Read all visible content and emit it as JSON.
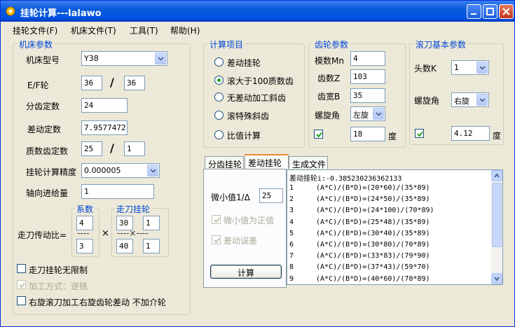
{
  "app": {
    "title": "挂轮计算---lalawo"
  },
  "menu": [
    "挂轮文件(F)",
    "机床文件(T)",
    "工具(T)",
    "帮助(H)"
  ],
  "machine": {
    "group": "机床参数",
    "model_label": "机床型号",
    "model_value": "Y38",
    "ef_label": "E/F轮",
    "ef_e": "36",
    "ef_sep": "/",
    "ef_f": "36",
    "div_label": "分齿定数",
    "div_value": "24",
    "diff_label": "差动定数",
    "diff_value": "7.9577472",
    "prime_label": "质数齿定数",
    "prime_a": "25",
    "prime_sep": "/",
    "prime_b": "1",
    "precision_label": "挂轮计算精度",
    "precision_value": "0.000005",
    "feed_label": "轴向进给量",
    "feed_value": "1",
    "ratio_label": "走刀传动比=",
    "coef_group": "系数",
    "coef_top": "4",
    "coef_bot": "3",
    "coef_dash": "----",
    "times": "×",
    "gear_group": "走刀挂轮",
    "gear_a": "30",
    "gear_b": "1",
    "gear_c": "40",
    "gear_d": "1",
    "gear_dash": "----×----",
    "opt_unlimited": "走刀挂轮无限制",
    "opt_method": "加工方式：逆铣",
    "opt_right": "右旋滚刀加工右旋齿轮差动 不加介轮"
  },
  "calc": {
    "group": "计算项目",
    "items": [
      "差动挂轮",
      "滚大于100质数齿",
      "无差动加工斜齿",
      "滚特殊斜齿",
      "比值计算"
    ],
    "selected_index": 1
  },
  "gear": {
    "group": "齿轮参数",
    "module_label": "模数Mn",
    "module_value": "4",
    "teeth_label": "齿数Z",
    "teeth_value": "103",
    "width_label": "齿宽B",
    "width_value": "35",
    "helix_label": "螺旋角",
    "helix_value": "左旋",
    "angle_value": "18",
    "angle_unit": "度"
  },
  "hob": {
    "group": "滚刀基本参数",
    "heads_label": "头数K",
    "heads_value": "1",
    "helix_label": "螺旋角",
    "helix_value": "右旋",
    "angle_value": "4.12",
    "angle_unit": "度"
  },
  "tabs": [
    "分齿挂轮",
    "差动挂轮",
    "生成文件"
  ],
  "panel": {
    "small_label": "微小值1/Δ",
    "small_value": "25",
    "opt_positive": "微小值为正值",
    "opt_error": "差动误差",
    "calc_button": "计算"
  },
  "results": {
    "header": "差动挂轮i:-0.385230236362133",
    "rows": [
      {
        "n": "1",
        "f": "(A*C)/(B*D)=(20*60)/(35*89)"
      },
      {
        "n": "2",
        "f": "(A*C)/(B*D)=(24*50)/(35*89)"
      },
      {
        "n": "3",
        "f": "(A*C)/(B*D)=(24*100)/(70*89)"
      },
      {
        "n": "4",
        "f": "(A*C)/(B*D)=(25*48)/(35*89)"
      },
      {
        "n": "5",
        "f": "(A*C)/(B*D)=(30*40)/(35*89)"
      },
      {
        "n": "6",
        "f": "(A*C)/(B*D)=(30*80)/(70*89)"
      },
      {
        "n": "7",
        "f": "(A*C)/(B*D)=(33*83)/(79*90)"
      },
      {
        "n": "8",
        "f": "(A*C)/(B*D)=(37*43)/(59*70)"
      },
      {
        "n": "9",
        "f": "(A*C)/(B*D)=(40*60)/(70*89)"
      }
    ]
  }
}
